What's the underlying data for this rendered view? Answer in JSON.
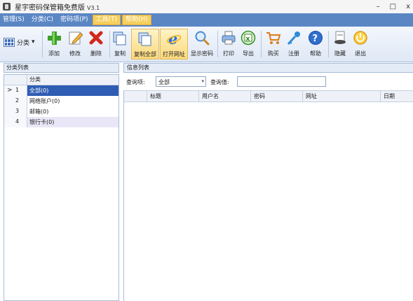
{
  "window": {
    "title": "星宇密码保管箱免费版",
    "version": "V3.1",
    "minimize": "–",
    "maximize": "□",
    "close": "x"
  },
  "menubar": {
    "items": [
      {
        "label": "管理(S)"
      },
      {
        "label": "分类(C)"
      },
      {
        "label": "密码项(P)"
      },
      {
        "label": "工具(T)"
      },
      {
        "label": "帮助(H)"
      }
    ]
  },
  "ribbon": {
    "category_label": "分类",
    "buttons": [
      {
        "label": "添加",
        "icon": "add-icon"
      },
      {
        "label": "修改",
        "icon": "edit-icon"
      },
      {
        "label": "删除",
        "icon": "delete-icon"
      },
      {
        "label": "复制",
        "icon": "copy-icon"
      },
      {
        "label": "复制全部",
        "icon": "copy-all-icon"
      },
      {
        "label": "打开网址",
        "icon": "ie-icon"
      },
      {
        "label": "显示密码",
        "icon": "magnifier-icon"
      },
      {
        "label": "打印",
        "icon": "printer-icon"
      },
      {
        "label": "导出",
        "icon": "excel-icon"
      },
      {
        "label": "购买",
        "icon": "cart-icon"
      },
      {
        "label": "注册",
        "icon": "key-icon"
      },
      {
        "label": "帮助",
        "icon": "help-icon"
      },
      {
        "label": "隐藏",
        "icon": "hide-icon"
      },
      {
        "label": "退出",
        "icon": "exit-icon"
      }
    ]
  },
  "left_panel": {
    "title": "分类列表",
    "column_header": "分类",
    "rows": [
      {
        "num": "1",
        "name": "全部(0)",
        "selected": true
      },
      {
        "num": "2",
        "name": "网络账户(0)"
      },
      {
        "num": "3",
        "name": "邮箱(0)"
      },
      {
        "num": "4",
        "name": "银行卡(0)"
      }
    ],
    "current_marker": ">"
  },
  "right_panel": {
    "title": "信息列表",
    "query_item_label": "查询项:",
    "query_item_value": "全部",
    "query_value_label": "查询值:",
    "query_value": "",
    "columns": [
      "标题",
      "用户名",
      "密码",
      "网址",
      "日期"
    ]
  },
  "colors": {
    "menubar": "#5a86c4",
    "menu_active": "#f6cf5c",
    "selection": "#2f5db3"
  }
}
